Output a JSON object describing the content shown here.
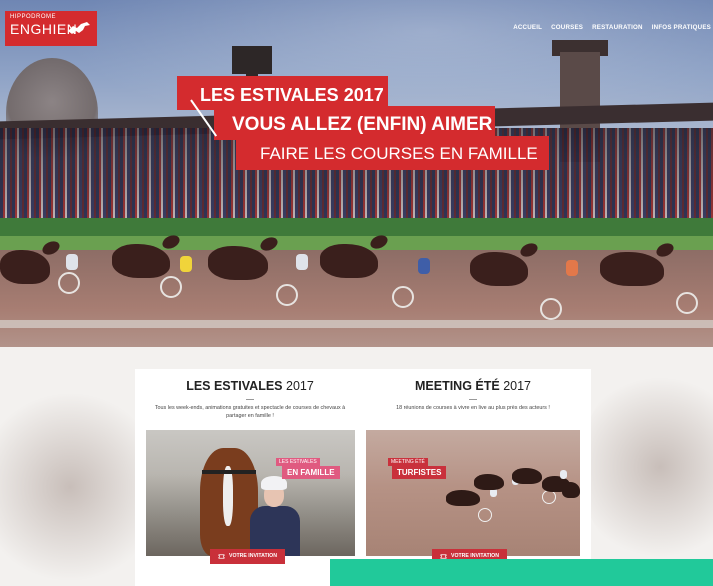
{
  "site": {
    "logo_small": "HIPPODROME",
    "logo_big": "ENGHIEN"
  },
  "nav": [
    "ACCUEIL",
    "COURSES",
    "RESTAURATION",
    "INFOS PRATIQUES"
  ],
  "hero": {
    "line1": "LES ESTIVALES 2017",
    "line2": "VOUS ALLEZ (ENFIN) AIMER",
    "line3": "FAIRE LES COURSES EN FAMILLE"
  },
  "cards": [
    {
      "title_bold": "LES ESTIVALES",
      "title_year": " 2017",
      "description": "Tous les week-ends, animations gratuites et spectacle de courses de chevaux à partager en famille !",
      "tag_small": "LES ESTIVALES",
      "tag_big": "EN FAMILLE",
      "button": "VOTRE INVITATION"
    },
    {
      "title_bold": "MEETING ÉTÉ",
      "title_year": " 2017",
      "description": "18 réunions de courses à vivre en live au plus près des acteurs !",
      "tag_small": "MEETING ÉTÉ",
      "tag_big": "TURFISTES",
      "button": "VOTRE INVITATION"
    }
  ],
  "colors": {
    "brand_red": "#d42b2e",
    "accent_teal": "#21c99a",
    "tag_pink": "#e05a80"
  },
  "icons": [
    "horse-logo-icon",
    "ticket-icon"
  ]
}
